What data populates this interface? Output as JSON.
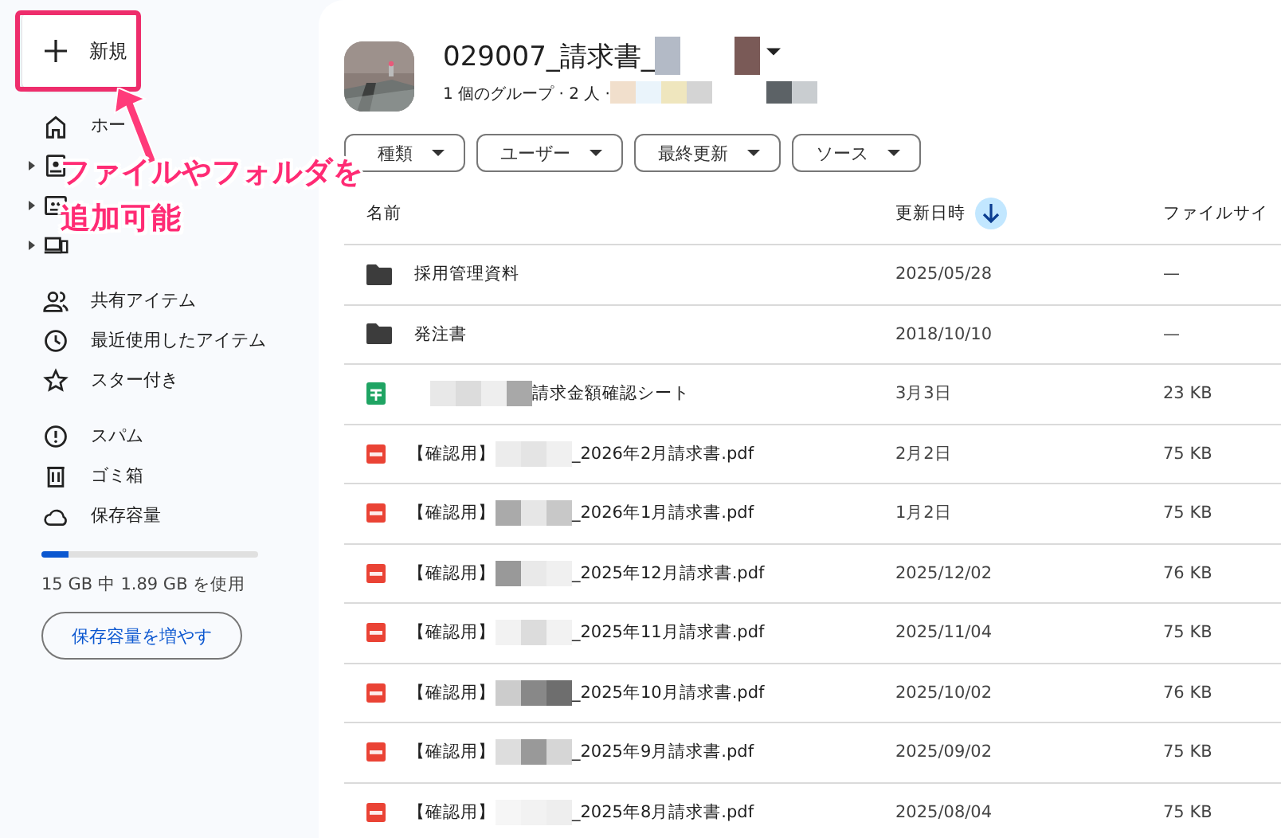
{
  "sidebar": {
    "new_button": {
      "label": "新規"
    },
    "nav_groups": [
      [
        {
          "label": "ホー",
          "expandable": false
        },
        {
          "expandable": true
        },
        {
          "expandable": true
        },
        {
          "expandable": true
        }
      ],
      [
        {
          "label": "共有アイテム",
          "expandable": false
        },
        {
          "label": "最近使用したアイテム",
          "expandable": false
        },
        {
          "label": "スター付き",
          "expandable": false
        }
      ],
      [
        {
          "label": "スパム",
          "expandable": false
        },
        {
          "label": "ゴミ箱",
          "expandable": false
        },
        {
          "label": "保存容量",
          "expandable": false
        }
      ]
    ],
    "storage": {
      "level": 0.126,
      "text": "15 GB 中 1.89 GB を使用",
      "button": "保存容量を増やす"
    }
  },
  "annotation": {
    "lines": [
      "ファイルやフォルダを",
      "追加可能"
    ]
  },
  "header": {
    "title": "029007_請求書_",
    "title_redacted": true,
    "subtitle": "1 個のグループ · 2 人 ·",
    "subtitle_redacted": true
  },
  "filters": [
    "種類",
    "ユーザー",
    "最終更新",
    "ソース"
  ],
  "table": {
    "columns": [
      {
        "label": "名前",
        "sorted": false
      },
      {
        "label": "更新日時",
        "sorted": true
      },
      {
        "label": "ファイルサイ",
        "sorted": false
      }
    ],
    "rows": [
      {
        "kind": "folder",
        "prefix": "採用管理資料",
        "redacted": false,
        "date": "2025/05/28",
        "size": "—"
      },
      {
        "kind": "folder",
        "prefix": "発注書",
        "redacted": false,
        "date": "2018/10/10",
        "size": "—"
      },
      {
        "kind": "sheet",
        "redacted": true,
        "suffix": "請求金額確認シート",
        "date": "3月3日",
        "size": "23 KB"
      },
      {
        "kind": "pdf",
        "prefix": "【確認用】",
        "redacted": true,
        "suffix": "_2026年2月請求書.pdf",
        "date": "2月2日",
        "size": "75 KB"
      },
      {
        "kind": "pdf",
        "prefix": "【確認用】",
        "redacted": true,
        "suffix": "_2026年1月請求書.pdf",
        "date": "1月2日",
        "size": "75 KB"
      },
      {
        "kind": "pdf",
        "prefix": "【確認用】",
        "redacted": true,
        "suffix": "_2025年12月請求書.pdf",
        "date": "2025/12/02",
        "size": "76 KB"
      },
      {
        "kind": "pdf",
        "prefix": "【確認用】",
        "redacted": true,
        "suffix": "_2025年11月請求書.pdf",
        "date": "2025/11/04",
        "size": "75 KB"
      },
      {
        "kind": "pdf",
        "prefix": "【確認用】",
        "redacted": true,
        "suffix": "_2025年10月請求書.pdf",
        "date": "2025/10/02",
        "size": "76 KB"
      },
      {
        "kind": "pdf",
        "prefix": "【確認用】",
        "redacted": true,
        "suffix": "_2025年9月請求書.pdf",
        "date": "2025/09/02",
        "size": "75 KB"
      },
      {
        "kind": "pdf",
        "prefix": "【確認用】",
        "redacted": true,
        "suffix": "_2025年8月請求書.pdf",
        "date": "2025/08/04",
        "size": "75 KB"
      }
    ]
  }
}
